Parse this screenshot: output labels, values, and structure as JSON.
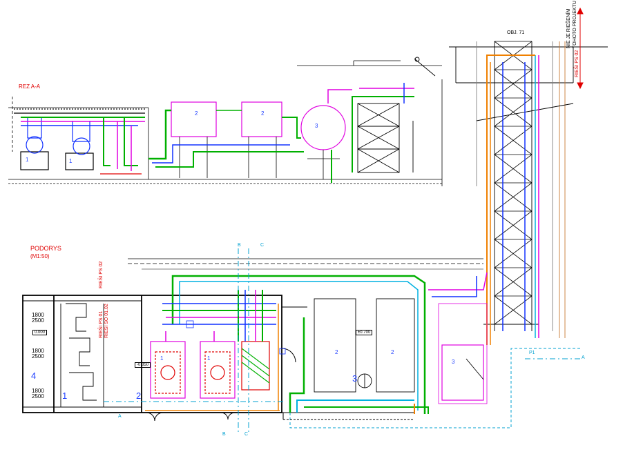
{
  "section_title": "REZ A-A",
  "plan_title": "PODORYS",
  "plan_scale": "(M1:50)",
  "object_label": "OBJ. 71",
  "out_of_scope_note": [
    "NIE JE RIEŠENÍM",
    "TOHOTO PROJEKTU"
  ],
  "ps_labels": {
    "ps02_top": "RIEŠI PS 02",
    "ps02_left": "RIEŠI PS 02",
    "ps01": "RIEŠI PS 01",
    "so": "RIEŠI SO 01.02"
  },
  "room_numbers": [
    "1",
    "2",
    "3",
    "4"
  ],
  "equipment_numbers": [
    "1",
    "2",
    "3"
  ],
  "dims": [
    "1800",
    "2500",
    "1800",
    "2500",
    "1800",
    "2500"
  ],
  "levels": [
    "0.000",
    "-0.850",
    "±0.700"
  ],
  "section_marks": {
    "a": "A",
    "b": "B",
    "c": "C",
    "p1": "P1"
  },
  "colors": {
    "line": "#000000",
    "green": "#00b000",
    "blue": "#1030ff",
    "magenta": "#e000e0",
    "orange": "#f08000",
    "cyan": "#00b0e0",
    "red": "#e00000",
    "tan": "#c87830",
    "gray": "#808080"
  }
}
